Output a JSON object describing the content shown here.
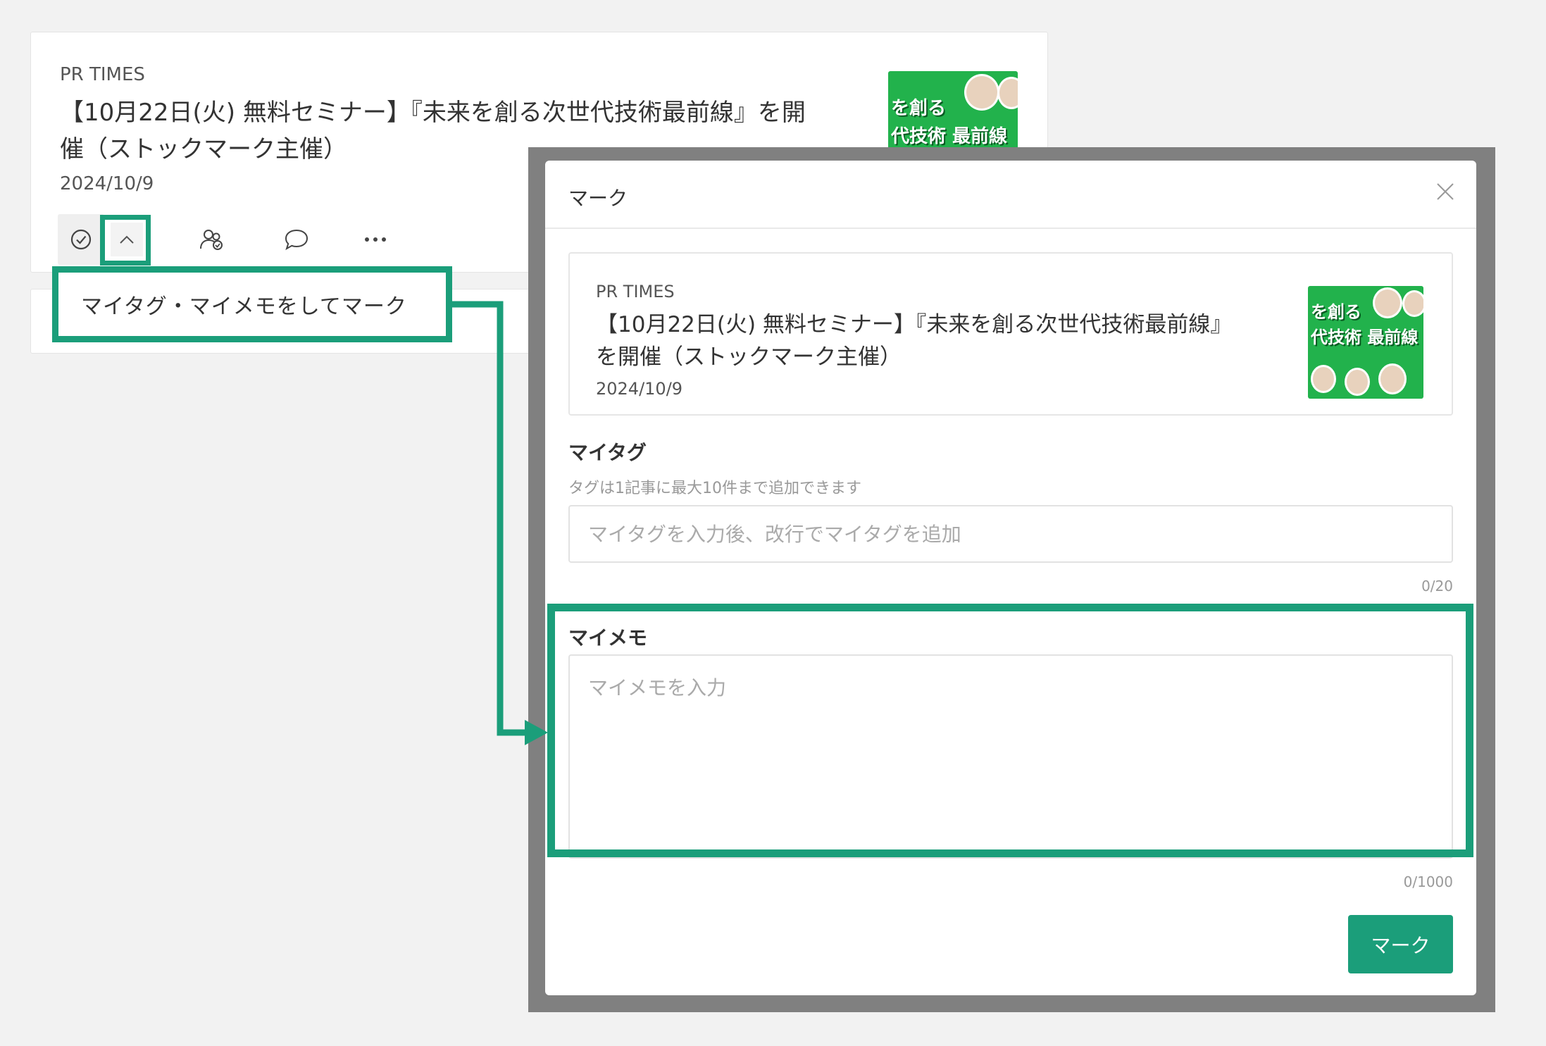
{
  "article": {
    "source": "PR TIMES",
    "title": "【10月22日(火) 無料セミナー】『未来を創る次世代技術最前線』を開催（ストックマーク主催）",
    "date": "2024/10/9",
    "thumbnail_lettering": "未来を創る 次世代技術 最前線"
  },
  "actions": {
    "icons": [
      "check-circle-icon",
      "chevron-up-icon",
      "people-icon",
      "comment-icon",
      "more-icon"
    ]
  },
  "tooltip": {
    "label": "マイタグ・マイメモをしてマーク"
  },
  "modal": {
    "title": "マーク",
    "close_icon": "close-icon",
    "preview": {
      "source": "PR TIMES",
      "title": "【10月22日(火) 無料セミナー】『未来を創る次世代技術最前線』を開催（ストックマーク主催）",
      "date": "2024/10/9"
    },
    "mytag": {
      "label": "マイタグ",
      "hint": "タグは1記事に最大10件まで追加できます",
      "placeholder": "マイタグを入力後、改行でマイタグを追加",
      "value": "",
      "counter": "0/20"
    },
    "mymemo": {
      "label": "マイメモ",
      "placeholder": "マイメモを入力",
      "value": "",
      "counter": "0/1000"
    },
    "submit_label": "マーク"
  },
  "colors": {
    "accent": "#1b9e7a",
    "overlay": "#808080",
    "thumbnail_green": "#22b24c"
  }
}
